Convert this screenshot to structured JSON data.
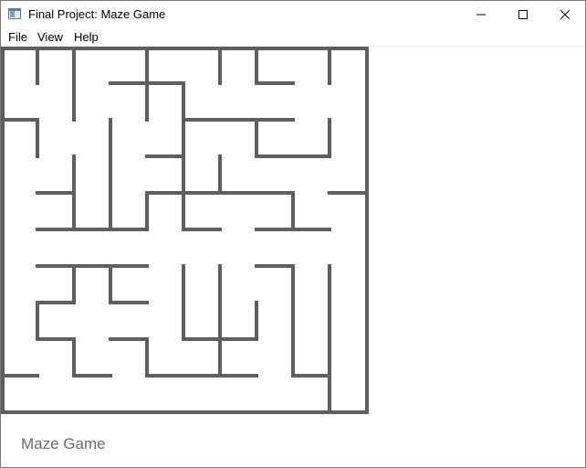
{
  "window": {
    "title": "Final Project: Maze Game",
    "app_icon": "window-app-icon",
    "buttons": {
      "minimize_icon": "minimize-icon",
      "maximize_icon": "maximize-icon",
      "close_icon": "close-icon"
    }
  },
  "menu": {
    "items": [
      {
        "label": "File"
      },
      {
        "label": "View"
      },
      {
        "label": "Help"
      }
    ]
  },
  "maze": {
    "columns": 10,
    "rows": 10,
    "wall_color": "#5f5f5f",
    "background_color": "#ffffff"
  },
  "status": {
    "label": "Maze Game"
  },
  "colors": {
    "window_border": "#777777",
    "status_text": "#6b6b6b"
  }
}
